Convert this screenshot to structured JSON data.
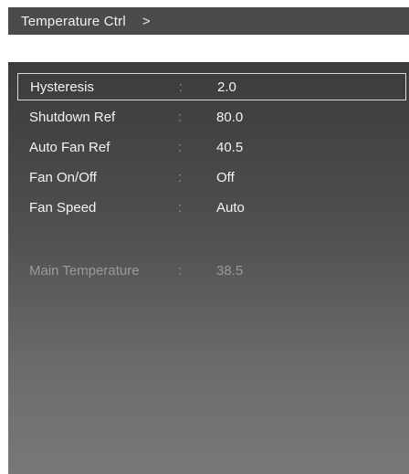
{
  "header": {
    "title": "Temperature Ctrl",
    "separator": ">"
  },
  "settings": [
    {
      "label": "Hysteresis",
      "colon": ":",
      "value": "2.0",
      "selected": true
    },
    {
      "label": "Shutdown Ref",
      "colon": ":",
      "value": "80.0",
      "selected": false
    },
    {
      "label": "Auto Fan Ref",
      "colon": ":",
      "value": "40.5",
      "selected": false
    },
    {
      "label": "Fan On/Off",
      "colon": ":",
      "value": "Off",
      "selected": false
    },
    {
      "label": "Fan Speed",
      "colon": ":",
      "value": "Auto",
      "selected": false
    }
  ],
  "status": {
    "label": "Main Temperature",
    "colon": ":",
    "value": "38.5"
  },
  "colors": {
    "header_bg": "#4b4b4b",
    "panel_top": "#3b3b3b",
    "panel_bottom": "#787878",
    "text": "#f4f4f4",
    "muted_text": "#9a9a9a",
    "selection_border": "#d8d8d8"
  }
}
